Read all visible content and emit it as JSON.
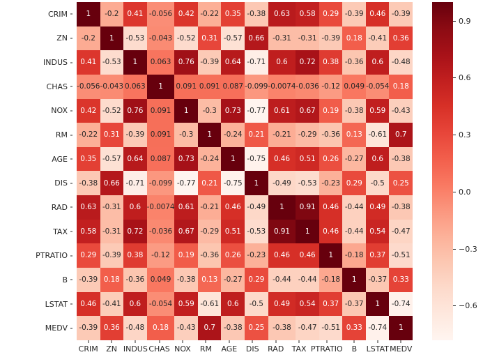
{
  "chart_data": {
    "type": "heatmap",
    "title": "",
    "xlabel": "",
    "ylabel": "",
    "grid": false,
    "legend_position": "right",
    "colormap": "Reds",
    "vmin": -0.78,
    "vmax": 1.0,
    "annotated": true,
    "categories": [
      "CRIM",
      "ZN",
      "INDUS",
      "CHAS",
      "NOX",
      "RM",
      "AGE",
      "DIS",
      "RAD",
      "TAX",
      "PTRATIO",
      "B",
      "LSTAT",
      "MEDV"
    ],
    "x": [
      "CRIM",
      "ZN",
      "INDUS",
      "CHAS",
      "NOX",
      "RM",
      "AGE",
      "DIS",
      "RAD",
      "TAX",
      "PTRATIO",
      "B",
      "LSTAT",
      "MEDV"
    ],
    "y": [
      "CRIM",
      "ZN",
      "INDUS",
      "CHAS",
      "NOX",
      "RM",
      "AGE",
      "DIS",
      "RAD",
      "TAX",
      "PTRATIO",
      "B",
      "LSTAT",
      "MEDV"
    ],
    "rows": [
      {
        "label": "CRIM",
        "values": [
          1,
          -0.2,
          0.41,
          -0.056,
          0.42,
          -0.22,
          0.35,
          -0.38,
          0.63,
          0.58,
          0.29,
          -0.39,
          0.46,
          -0.39
        ],
        "labels": [
          "1",
          "-0.2",
          "0.41",
          "-0.056",
          "0.42",
          "-0.22",
          "0.35",
          "-0.38",
          "0.63",
          "0.58",
          "0.29",
          "-0.39",
          "0.46",
          "-0.39"
        ]
      },
      {
        "label": "ZN",
        "values": [
          -0.2,
          1,
          -0.53,
          -0.043,
          -0.52,
          0.31,
          -0.57,
          0.66,
          -0.31,
          -0.31,
          -0.39,
          0.18,
          -0.41,
          0.36
        ],
        "labels": [
          "-0.2",
          "1",
          "-0.53",
          "-0.043",
          "-0.52",
          "0.31",
          "-0.57",
          "0.66",
          "-0.31",
          "-0.31",
          "-0.39",
          "0.18",
          "-0.41",
          "0.36"
        ]
      },
      {
        "label": "INDUS",
        "values": [
          0.41,
          -0.53,
          1,
          0.063,
          0.76,
          -0.39,
          0.64,
          -0.71,
          0.6,
          0.72,
          0.38,
          -0.36,
          0.6,
          -0.48
        ],
        "labels": [
          "0.41",
          "-0.53",
          "1",
          "0.063",
          "0.76",
          "-0.39",
          "0.64",
          "-0.71",
          "0.6",
          "0.72",
          "0.38",
          "-0.36",
          "0.6",
          "-0.48"
        ]
      },
      {
        "label": "CHAS",
        "values": [
          -0.056,
          -0.043,
          0.063,
          1,
          0.091,
          0.091,
          0.087,
          -0.099,
          -0.0074,
          -0.036,
          -0.12,
          0.049,
          -0.054,
          0.18
        ],
        "labels": [
          "-0.056",
          "-0.043",
          "0.063",
          "1",
          "0.091",
          "0.091",
          "0.087",
          "-0.099",
          "-0.0074",
          "-0.036",
          "-0.12",
          "0.049",
          "-0.054",
          "0.18"
        ]
      },
      {
        "label": "NOX",
        "values": [
          0.42,
          -0.52,
          0.76,
          0.091,
          1,
          -0.3,
          0.73,
          -0.77,
          0.61,
          0.67,
          0.19,
          -0.38,
          0.59,
          -0.43
        ],
        "labels": [
          "0.42",
          "-0.52",
          "0.76",
          "0.091",
          "1",
          "-0.3",
          "0.73",
          "-0.77",
          "0.61",
          "0.67",
          "0.19",
          "-0.38",
          "0.59",
          "-0.43"
        ]
      },
      {
        "label": "RM",
        "values": [
          -0.22,
          0.31,
          -0.39,
          0.091,
          -0.3,
          1,
          -0.24,
          0.21,
          -0.21,
          -0.29,
          -0.36,
          0.13,
          -0.61,
          0.7
        ],
        "labels": [
          "-0.22",
          "0.31",
          "-0.39",
          "0.091",
          "-0.3",
          "1",
          "-0.24",
          "0.21",
          "-0.21",
          "-0.29",
          "-0.36",
          "0.13",
          "-0.61",
          "0.7"
        ]
      },
      {
        "label": "AGE",
        "values": [
          0.35,
          -0.57,
          0.64,
          0.087,
          0.73,
          -0.24,
          1,
          -0.75,
          0.46,
          0.51,
          0.26,
          -0.27,
          0.6,
          -0.38
        ],
        "labels": [
          "0.35",
          "-0.57",
          "0.64",
          "0.087",
          "0.73",
          "-0.24",
          "1",
          "-0.75",
          "0.46",
          "0.51",
          "0.26",
          "-0.27",
          "0.6",
          "-0.38"
        ]
      },
      {
        "label": "DIS",
        "values": [
          -0.38,
          0.66,
          -0.71,
          -0.099,
          -0.77,
          0.21,
          -0.75,
          1,
          -0.49,
          -0.53,
          -0.23,
          0.29,
          -0.5,
          0.25
        ],
        "labels": [
          "-0.38",
          "0.66",
          "-0.71",
          "-0.099",
          "-0.77",
          "0.21",
          "-0.75",
          "1",
          "-0.49",
          "-0.53",
          "-0.23",
          "0.29",
          "-0.5",
          "0.25"
        ]
      },
      {
        "label": "RAD",
        "values": [
          0.63,
          -0.31,
          0.6,
          -0.0074,
          0.61,
          -0.21,
          0.46,
          -0.49,
          1,
          0.91,
          0.46,
          -0.44,
          0.49,
          -0.38
        ],
        "labels": [
          "0.63",
          "-0.31",
          "0.6",
          "-0.0074",
          "0.61",
          "-0.21",
          "0.46",
          "-0.49",
          "1",
          "0.91",
          "0.46",
          "-0.44",
          "0.49",
          "-0.38"
        ]
      },
      {
        "label": "TAX",
        "values": [
          0.58,
          -0.31,
          0.72,
          -0.036,
          0.67,
          -0.29,
          0.51,
          -0.53,
          0.91,
          1,
          0.46,
          -0.44,
          0.54,
          -0.47
        ],
        "labels": [
          "0.58",
          "-0.31",
          "0.72",
          "-0.036",
          "0.67",
          "-0.29",
          "0.51",
          "-0.53",
          "0.91",
          "1",
          "0.46",
          "-0.44",
          "0.54",
          "-0.47"
        ]
      },
      {
        "label": "PTRATIO",
        "values": [
          0.29,
          -0.39,
          0.38,
          -0.12,
          0.19,
          -0.36,
          0.26,
          -0.23,
          0.46,
          0.46,
          1,
          -0.18,
          0.37,
          -0.51
        ],
        "labels": [
          "0.29",
          "-0.39",
          "0.38",
          "-0.12",
          "0.19",
          "-0.36",
          "0.26",
          "-0.23",
          "0.46",
          "0.46",
          "1",
          "-0.18",
          "0.37",
          "-0.51"
        ]
      },
      {
        "label": "B",
        "values": [
          -0.39,
          0.18,
          -0.36,
          0.049,
          -0.38,
          0.13,
          -0.27,
          0.29,
          -0.44,
          -0.44,
          -0.18,
          1,
          -0.37,
          0.33
        ],
        "labels": [
          "-0.39",
          "0.18",
          "-0.36",
          "0.049",
          "-0.38",
          "0.13",
          "-0.27",
          "0.29",
          "-0.44",
          "-0.44",
          "-0.18",
          "1",
          "-0.37",
          "0.33"
        ]
      },
      {
        "label": "LSTAT",
        "values": [
          0.46,
          -0.41,
          0.6,
          -0.054,
          0.59,
          -0.61,
          0.6,
          -0.5,
          0.49,
          0.54,
          0.37,
          -0.37,
          1,
          -0.74
        ],
        "labels": [
          "0.46",
          "-0.41",
          "0.6",
          "-0.054",
          "0.59",
          "-0.61",
          "0.6",
          "-0.5",
          "0.49",
          "0.54",
          "0.37",
          "-0.37",
          "1",
          "-0.74"
        ]
      },
      {
        "label": "MEDV",
        "values": [
          -0.39,
          0.36,
          -0.48,
          0.18,
          -0.43,
          0.7,
          -0.38,
          0.25,
          -0.38,
          -0.47,
          -0.51,
          0.33,
          -0.74,
          1
        ],
        "labels": [
          "-0.39",
          "0.36",
          "-0.48",
          "0.18",
          "-0.43",
          "0.7",
          "-0.38",
          "0.25",
          "-0.38",
          "-0.47",
          "-0.51",
          "0.33",
          "-0.74",
          "1"
        ]
      }
    ],
    "colorbar": {
      "ticks": [
        0.9,
        0.6,
        0.3,
        0.0,
        -0.3,
        -0.6
      ],
      "tick_labels": [
        "0.9",
        "0.6",
        "0.3",
        "0.0",
        "−0.3",
        "−0.6"
      ],
      "orientation": "vertical",
      "min_color": "#fff5f0",
      "max_color": "#67000d"
    }
  }
}
